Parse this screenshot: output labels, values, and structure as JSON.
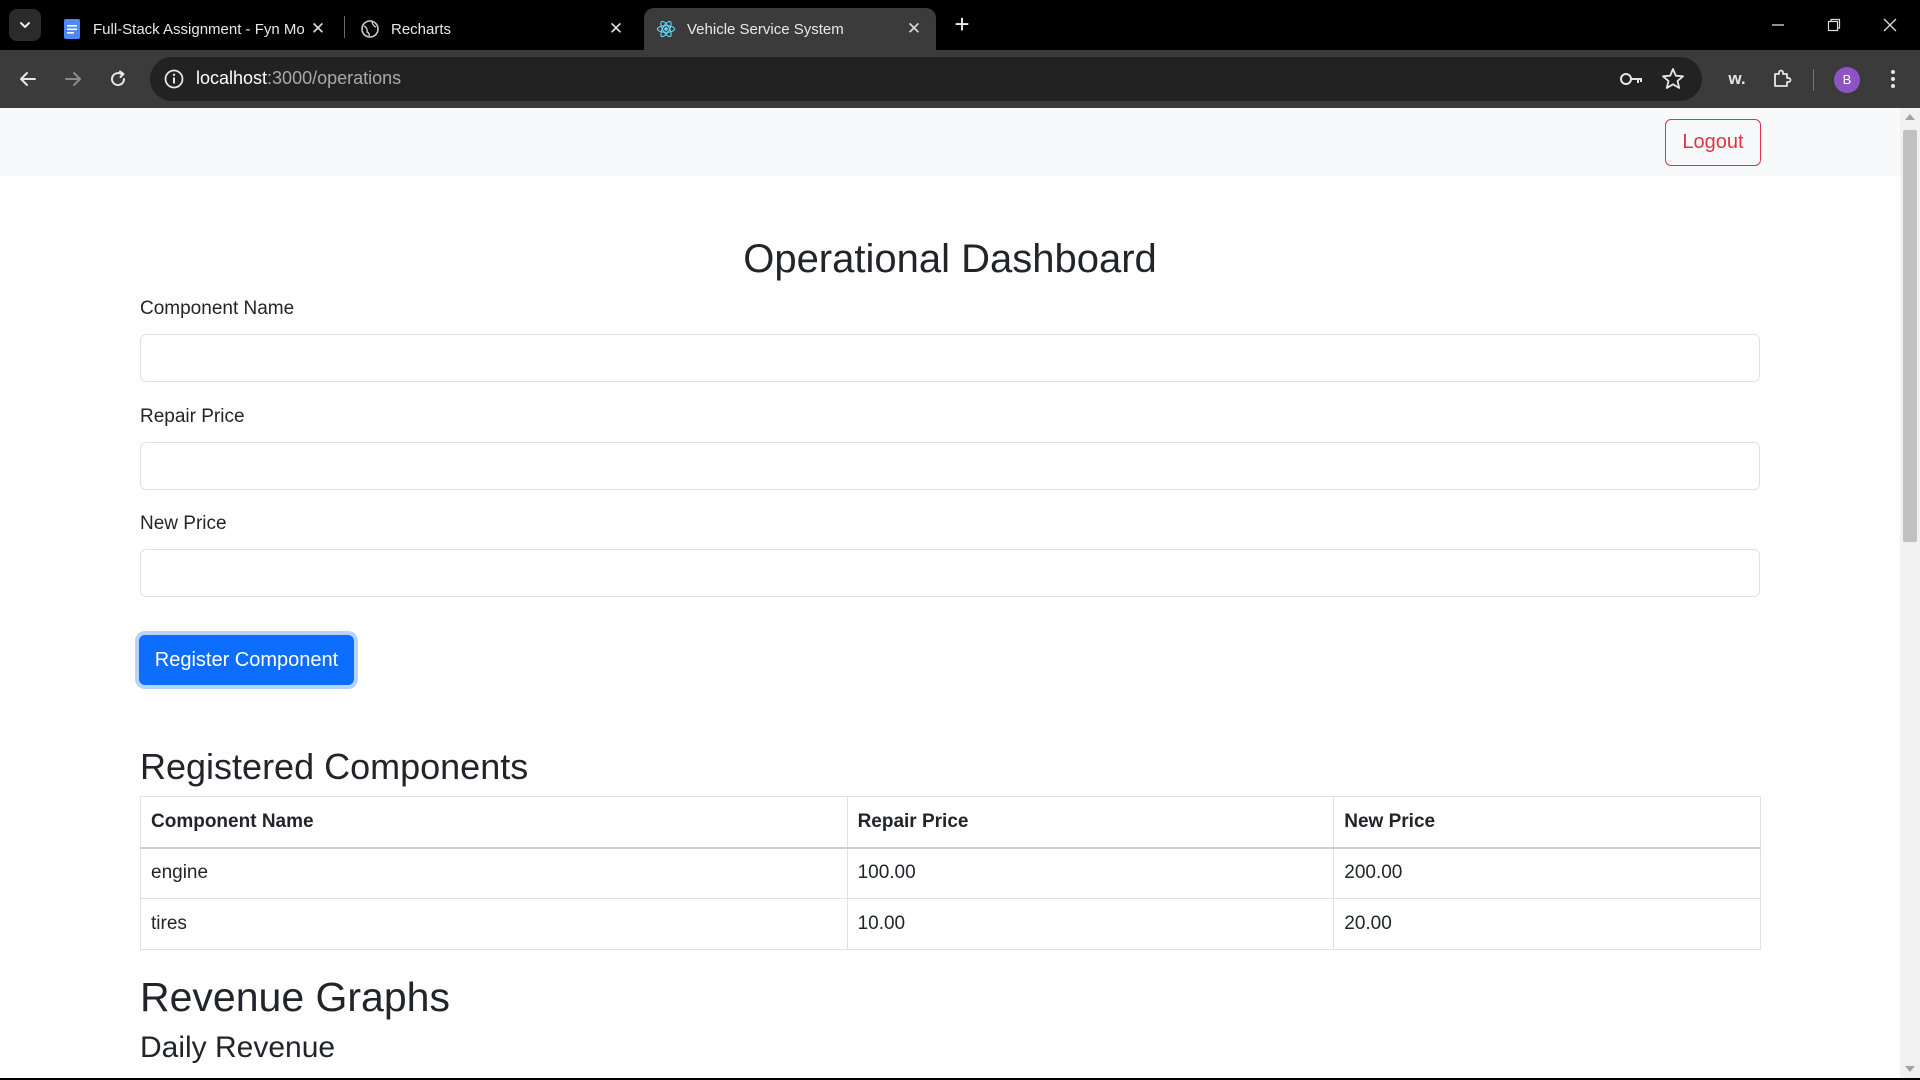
{
  "browser": {
    "tabs": [
      {
        "title": "Full-Stack Assignment - Fyn Mo",
        "icon": "docs-icon"
      },
      {
        "title": "Recharts",
        "icon": "globe-icon"
      },
      {
        "title": "Vehicle Service System",
        "icon": "react-icon"
      }
    ],
    "active_tab_index": 2,
    "url_host": "localhost",
    "url_rest": ":3000/operations",
    "profile_initial": "B",
    "extension_label": "w."
  },
  "nav": {
    "logout_label": "Logout"
  },
  "page": {
    "title": "Operational Dashboard"
  },
  "form": {
    "component_name_label": "Component Name",
    "component_name_value": "",
    "repair_price_label": "Repair Price",
    "repair_price_value": "",
    "new_price_label": "New Price",
    "new_price_value": "",
    "submit_label": "Register Component"
  },
  "registered": {
    "heading": "Registered Components",
    "columns": [
      "Component Name",
      "Repair Price",
      "New Price"
    ],
    "rows": [
      [
        "engine",
        "100.00",
        "200.00"
      ],
      [
        "tires",
        "10.00",
        "20.00"
      ]
    ]
  },
  "revenue": {
    "heading": "Revenue Graphs",
    "daily_heading": "Daily Revenue"
  },
  "colors": {
    "primary": "#0d6efd",
    "danger": "#dc3545",
    "nav_bg": "#f8f9fa",
    "profile": "#8e54c5"
  }
}
